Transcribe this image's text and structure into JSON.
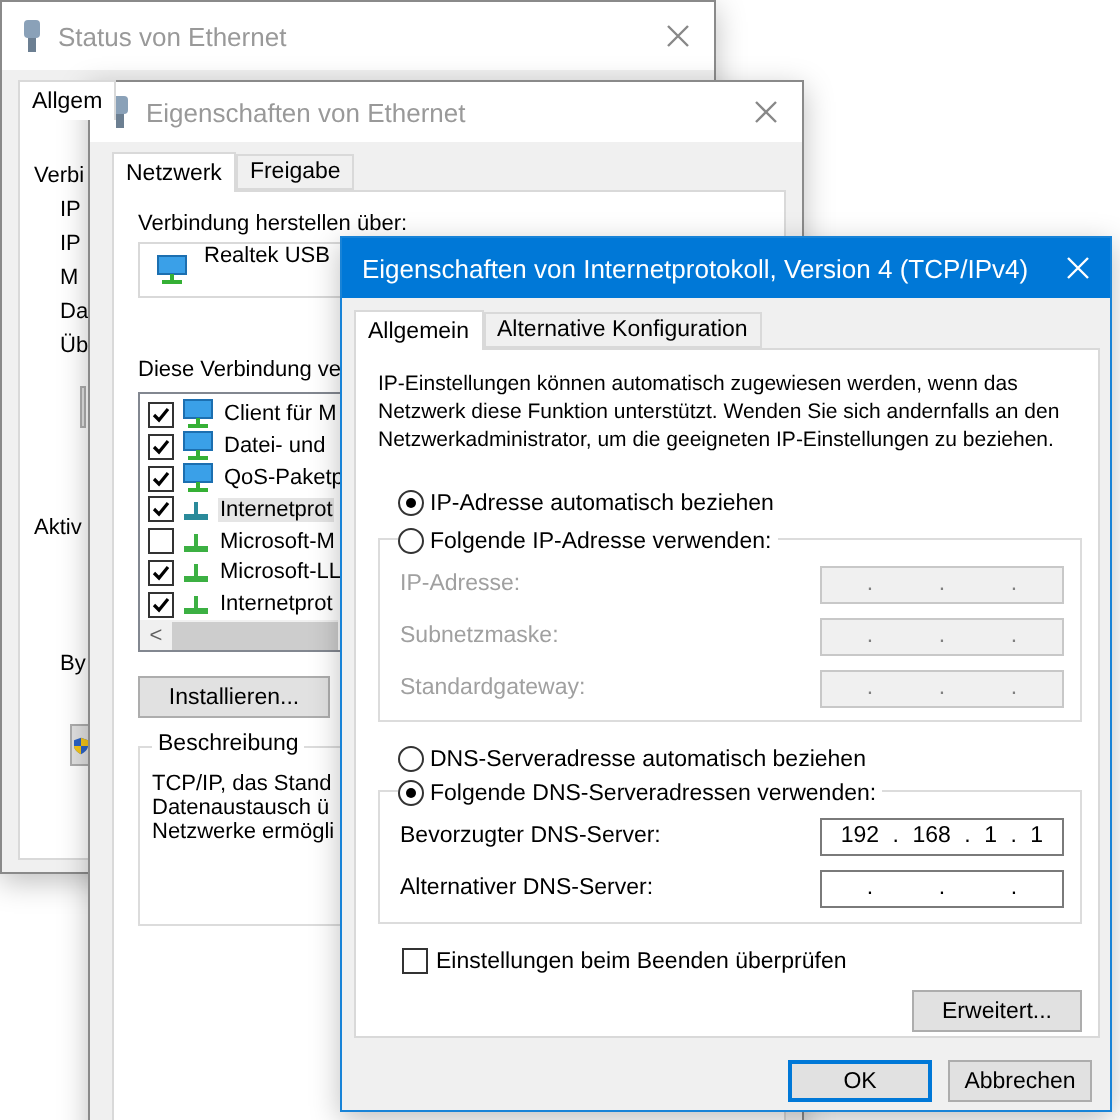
{
  "status_window": {
    "title": "Status von Ethernet",
    "active": false,
    "tabs": [
      {
        "label": "Allgem",
        "selected": true
      }
    ],
    "connection_labels": [
      "Verbi",
      "IP",
      "IP",
      "M",
      "Da",
      "Üb"
    ],
    "activity_label": "Aktiv",
    "bytes_label": "By"
  },
  "ethernet_window": {
    "title": "Eigenschaften von Ethernet",
    "active": false,
    "tabs": [
      {
        "label": "Netzwerk",
        "selected": true
      },
      {
        "label": "Freigabe",
        "selected": false
      }
    ],
    "connect_label": "Verbindung herstellen über:",
    "adapter": "Realtek USB",
    "components_label": "Diese Verbindung ve",
    "components": [
      {
        "label": "Client für M",
        "kind": "client",
        "checked": true,
        "selected": false
      },
      {
        "label": "Datei- und",
        "kind": "service",
        "checked": true,
        "selected": false
      },
      {
        "label": "QoS-Paketp",
        "kind": "service",
        "checked": true,
        "selected": false
      },
      {
        "label": "Internetprot",
        "kind": "protocol",
        "checked": true,
        "selected": true
      },
      {
        "label": "Microsoft-M",
        "kind": "protocol",
        "checked": false,
        "selected": false
      },
      {
        "label": "Microsoft-LL",
        "kind": "protocol",
        "checked": true,
        "selected": false
      },
      {
        "label": "Internetprot",
        "kind": "protocol",
        "checked": true,
        "selected": false
      }
    ],
    "scroll_left": "<",
    "install_button": "Installieren...",
    "description": {
      "title": "Beschreibung",
      "lines": [
        "TCP/IP, das Stand",
        "Datenaustausch ü",
        "Netzwerke ermögli"
      ]
    }
  },
  "ipv4_dialog": {
    "title": "Eigenschaften von Internetprotokoll, Version 4 (TCP/IPv4)",
    "active": true,
    "tabs": [
      {
        "label": "Allgemein",
        "selected": true
      },
      {
        "label": "Alternative Konfiguration",
        "selected": false
      }
    ],
    "intro": "IP-Einstellungen können automatisch zugewiesen werden, wenn das Netzwerk diese Funktion unterstützt. Wenden Sie sich andernfalls an den Netzwerkadministrator, um die geeigneten IP-Einstellungen zu beziehen.",
    "ip_modes": [
      {
        "label": "IP-Adresse automatisch beziehen",
        "selected": true
      },
      {
        "label": "Folgende IP-Adresse verwenden:",
        "selected": false
      }
    ],
    "ip_fields": [
      {
        "label": "IP-Adresse:",
        "disabled": true,
        "parts": [
          ".",
          ".",
          "."
        ]
      },
      {
        "label": "Subnetzmaske:",
        "disabled": true,
        "parts": [
          ".",
          ".",
          "."
        ]
      },
      {
        "label": "Standardgateway:",
        "disabled": true,
        "parts": [
          ".",
          ".",
          "."
        ]
      }
    ],
    "dns_modes": [
      {
        "label": "DNS-Serveradresse automatisch beziehen",
        "selected": false
      },
      {
        "label": "Folgende DNS-Serveradressen verwenden:",
        "selected": true
      }
    ],
    "dns_fields": [
      {
        "label": "Bevorzugter DNS-Server:",
        "disabled": false,
        "parts": [
          "192",
          ".",
          "168",
          ".",
          "1",
          ".",
          "1"
        ]
      },
      {
        "label": "Alternativer DNS-Server:",
        "disabled": false,
        "parts": [
          ".",
          ".",
          "."
        ]
      }
    ],
    "validate_checkbox": {
      "label": "Einstellungen beim Beenden überprüfen",
      "checked": false
    },
    "advanced_button": "Erweitert...",
    "buttons": [
      {
        "label": "OK",
        "default": true
      },
      {
        "label": "Abbrechen",
        "default": false
      }
    ]
  }
}
